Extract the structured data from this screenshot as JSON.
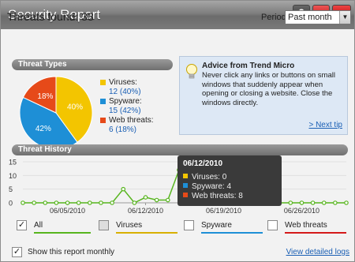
{
  "window": {
    "title": "Security Report",
    "help_label": "?",
    "minimize_label": "–",
    "close_label": "x"
  },
  "summary": {
    "threats_found": "Threats found: 33",
    "period_label": "Period:",
    "period_value": "Past month"
  },
  "threat_types": {
    "heading": "Threat Types",
    "items": [
      {
        "name": "Viruses:",
        "value": "12 (40%)",
        "pie_label": "40%",
        "percent": 40,
        "color": "#f3c500"
      },
      {
        "name": "Spyware:",
        "value": "15 (42%)",
        "pie_label": "42%",
        "percent": 42,
        "color": "#1e8fd6"
      },
      {
        "name": "Web threats:",
        "value": "6 (18%)",
        "pie_label": "18%",
        "percent": 18,
        "color": "#e64a19"
      }
    ]
  },
  "advice": {
    "title": "Advice from Trend Micro",
    "text": "Never click any links or buttons on small windows that suddenly appear when opening or closing a website. Close the windows directly.",
    "link": "> Next tip"
  },
  "history": {
    "heading": "Threat History",
    "tooltip": {
      "date": "06/12/2010",
      "rows": [
        {
          "text": "Viruses: 0",
          "color": "#f3c500"
        },
        {
          "text": "Spyware: 4",
          "color": "#1e8fd6"
        },
        {
          "text": "Web threats: 8",
          "color": "#e64a19"
        }
      ]
    },
    "filters": [
      {
        "label": "All",
        "checked": true,
        "color": "#57b51e"
      },
      {
        "label": "Viruses",
        "checked": false,
        "color": "#d8b000"
      },
      {
        "label": "Spyware",
        "checked": false,
        "color": "#1e8fd6"
      },
      {
        "label": "Web threats",
        "checked": false,
        "color": "#d41a1a"
      }
    ]
  },
  "footer": {
    "monthly_label": "Show this report monthly",
    "monthly_checked": true,
    "link": "View detailed logs"
  },
  "chart_data": [
    {
      "type": "pie",
      "title": "",
      "categories": [
        "Viruses",
        "Spyware",
        "Web threats"
      ],
      "values": [
        40,
        42,
        18
      ]
    },
    {
      "type": "line",
      "title": "",
      "xlabel": "",
      "ylabel": "",
      "ylim": [
        0,
        15
      ],
      "yticks": [
        0,
        5,
        10,
        15
      ],
      "x_tick_labels": [
        "06/05/2010",
        "06/12/2010",
        "06/19/2010",
        "06/26/2010"
      ],
      "grid": true,
      "series": [
        {
          "name": "All",
          "x": [
            "06/01",
            "06/02",
            "06/03",
            "06/04",
            "06/05",
            "06/06",
            "06/07",
            "06/08",
            "06/09",
            "06/10",
            "06/11",
            "06/12",
            "06/13",
            "06/14",
            "06/15",
            "06/16",
            "06/17",
            "06/18",
            "06/19",
            "06/20",
            "06/21",
            "06/22",
            "06/23",
            "06/24",
            "06/25",
            "06/26",
            "06/27",
            "06/28",
            "06/29",
            "06/30"
          ],
          "values": [
            0,
            0,
            0,
            0,
            0,
            0,
            0,
            0,
            0,
            5,
            0,
            2,
            1,
            1,
            12,
            0,
            0,
            0,
            0,
            0,
            0,
            0,
            0,
            0,
            0,
            0,
            0,
            0,
            0,
            0
          ]
        }
      ]
    }
  ]
}
